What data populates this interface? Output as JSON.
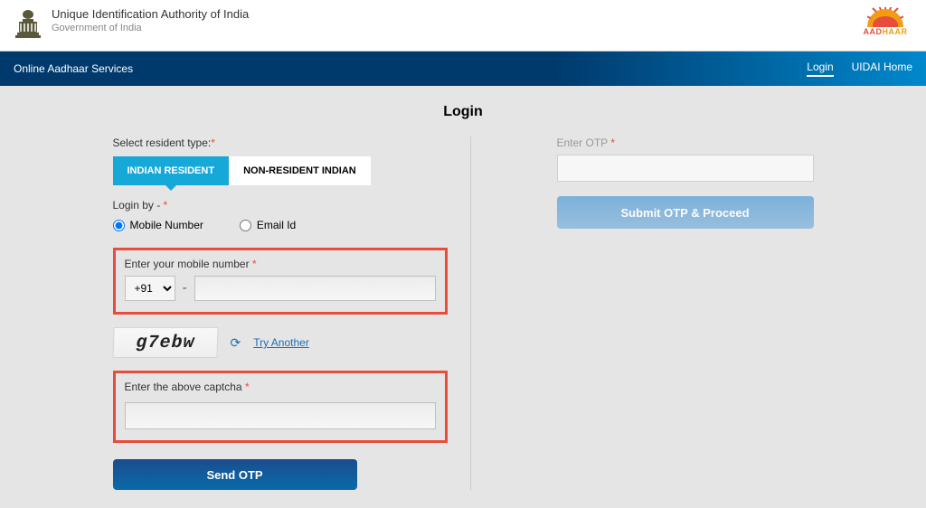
{
  "header": {
    "org_title": "Unique Identification Authority of India",
    "gov_text": "Government of India",
    "logo_text": "AADHAAR"
  },
  "navbar": {
    "service_title": "Online Aadhaar Services",
    "links": {
      "login": "Login",
      "home": "UIDAI Home"
    }
  },
  "page": {
    "title": "Login"
  },
  "left": {
    "resident_type_label": "Select resident type:",
    "tabs": {
      "indian": "INDIAN RESIDENT",
      "nri": "NON-RESIDENT INDIAN"
    },
    "login_by_label": "Login by - ",
    "radios": {
      "mobile": "Mobile Number",
      "email": "Email Id"
    },
    "mobile_field_label": "Enter your mobile number ",
    "country_code": "+91",
    "dash": "-",
    "captcha_text": "g7ebw",
    "try_another": "Try Another",
    "captcha_field_label": "Enter the above captcha ",
    "send_otp": "Send OTP"
  },
  "right": {
    "otp_label": "Enter OTP ",
    "submit": "Submit OTP & Proceed"
  }
}
